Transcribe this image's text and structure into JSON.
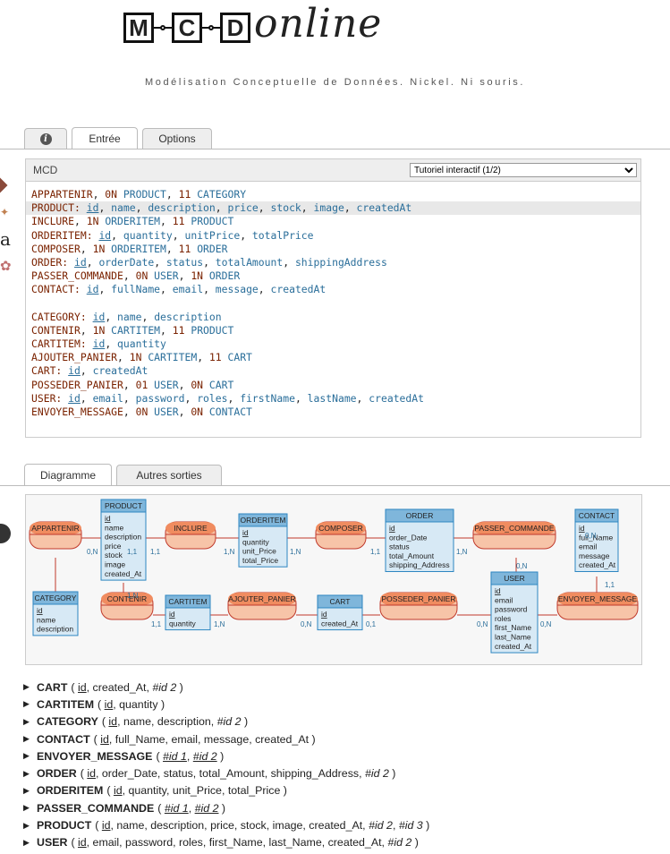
{
  "header": {
    "logo_boxes": [
      "M",
      "C",
      "D"
    ],
    "logo_script": "online",
    "tagline": "Modélisation Conceptuelle de Données. Nickel. Ni souris."
  },
  "top_tabs": [
    {
      "label": "i",
      "icon": "info-icon"
    },
    {
      "label": "Entrée"
    },
    {
      "label": "Options"
    }
  ],
  "mcd_panel": {
    "title": "MCD",
    "tutorial_select": "Tutoriel interactif (1/2)",
    "lines": [
      "APPARTENIR, 0N PRODUCT, 11 CATEGORY",
      "PRODUCT: id, name, description, price, stock, image, createdAt",
      "INCLURE, 1N ORDERITEM, 11 PRODUCT",
      "ORDERITEM: id, quantity, unitPrice, totalPrice",
      "COMPOSER, 1N ORDERITEM, 11 ORDER",
      "ORDER: id, orderDate, status, totalAmount, shippingAddress",
      "PASSER_COMMANDE, 0N USER, 1N ORDER",
      "CONTACT: id, fullName, email, message, createdAt",
      "",
      "CATEGORY: id, name, description",
      "CONTENIR, 1N CARTITEM, 11 PRODUCT",
      "CARTITEM: id, quantity",
      "AJOUTER_PANIER, 1N CARTITEM, 11 CART",
      "CART: id, createdAt",
      "POSSEDER_PANIER, 01 USER, 0N CART",
      "USER: id, email, password, roles, firstName, lastName, createdAt",
      "ENVOYER_MESSAGE, 0N USER, 0N CONTACT"
    ]
  },
  "output_tabs": [
    {
      "label": "Diagramme"
    },
    {
      "label": "Autres sorties"
    }
  ],
  "diagram": {
    "entities": [
      {
        "name": "PRODUCT",
        "attrs": [
          "id",
          "name",
          "description",
          "price",
          "stock",
          "image",
          "created_At"
        ]
      },
      {
        "name": "ORDERITEM",
        "attrs": [
          "id",
          "quantity",
          "unit_Price",
          "total_Price"
        ]
      },
      {
        "name": "ORDER",
        "attrs": [
          "id",
          "order_Date",
          "status",
          "total_Amount",
          "shipping_Address"
        ]
      },
      {
        "name": "CONTACT",
        "attrs": [
          "id",
          "full_Name",
          "email",
          "message",
          "created_At"
        ]
      },
      {
        "name": "CATEGORY",
        "attrs": [
          "id",
          "name",
          "description"
        ]
      },
      {
        "name": "CARTITEM",
        "attrs": [
          "id",
          "quantity"
        ]
      },
      {
        "name": "CART",
        "attrs": [
          "id",
          "created_At"
        ]
      },
      {
        "name": "USER",
        "attrs": [
          "id",
          "email",
          "password",
          "roles",
          "first_Name",
          "last_Name",
          "created_At"
        ]
      }
    ],
    "associations": [
      "APPARTENIR",
      "INCLURE",
      "COMPOSER",
      "PASSER_COMMANDE",
      "CONTENIR",
      "AJOUTER_PANIER",
      "POSSEDER_PANIER",
      "ENVOYER_MESSAGE"
    ],
    "cardinalities": [
      "0,N",
      "1,1",
      "1,1",
      "1,N",
      "1,N",
      "1,1",
      "1,N",
      "0,N",
      "1,1",
      "1,N",
      "1,1",
      "1,N",
      "0,N",
      "0,1",
      "0,N",
      "0,N",
      "0,N"
    ]
  },
  "relations": [
    {
      "name": "CART",
      "args": "( id, created_At, #id 2 )"
    },
    {
      "name": "CARTITEM",
      "args": "( id, quantity )"
    },
    {
      "name": "CATEGORY",
      "args": "( id, name, description, #id 2 )"
    },
    {
      "name": "CONTACT",
      "args": "( id, full_Name, email, message, created_At )"
    },
    {
      "name": "ENVOYER_MESSAGE",
      "args": "( #id 1, #id 2 )"
    },
    {
      "name": "ORDER",
      "args": "( id, order_Date, status, total_Amount, shipping_Address, #id 2 )"
    },
    {
      "name": "ORDERITEM",
      "args": "( id, quantity, unit_Price, total_Price )"
    },
    {
      "name": "PASSER_COMMANDE",
      "args": "( #id 1, #id 2 )"
    },
    {
      "name": "PRODUCT",
      "args": "( id, name, description, price, stock, image, created_At, #id 2, #id 3 )"
    },
    {
      "name": "USER",
      "args": "( id, email, password, roles, first_Name, last_Name, created_At, #id 2 )"
    }
  ]
}
